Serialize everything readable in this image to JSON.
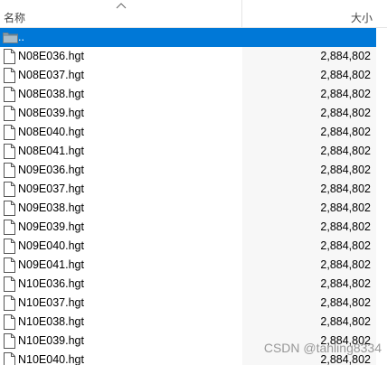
{
  "header": {
    "name_label": "名称",
    "size_label": "大小"
  },
  "parent_row": {
    "name": "..",
    "icon": "folder-icon",
    "size": ""
  },
  "files": [
    {
      "name": "N08E036.hgt",
      "size": "2,884,802"
    },
    {
      "name": "N08E037.hgt",
      "size": "2,884,802"
    },
    {
      "name": "N08E038.hgt",
      "size": "2,884,802"
    },
    {
      "name": "N08E039.hgt",
      "size": "2,884,802"
    },
    {
      "name": "N08E040.hgt",
      "size": "2,884,802"
    },
    {
      "name": "N08E041.hgt",
      "size": "2,884,802"
    },
    {
      "name": "N09E036.hgt",
      "size": "2,884,802"
    },
    {
      "name": "N09E037.hgt",
      "size": "2,884,802"
    },
    {
      "name": "N09E038.hgt",
      "size": "2,884,802"
    },
    {
      "name": "N09E039.hgt",
      "size": "2,884,802"
    },
    {
      "name": "N09E040.hgt",
      "size": "2,884,802"
    },
    {
      "name": "N09E041.hgt",
      "size": "2,884,802"
    },
    {
      "name": "N10E036.hgt",
      "size": "2,884,802"
    },
    {
      "name": "N10E037.hgt",
      "size": "2,884,802"
    },
    {
      "name": "N10E038.hgt",
      "size": "2,884,802"
    },
    {
      "name": "N10E039.hgt",
      "size": "2,884,802"
    },
    {
      "name": "N10E040.hgt",
      "size": "2,884,802"
    }
  ],
  "watermark": "CSDN @tanling8334",
  "colors": {
    "selection": "#0078d7",
    "size_column_bg": "#f7f7f7"
  }
}
